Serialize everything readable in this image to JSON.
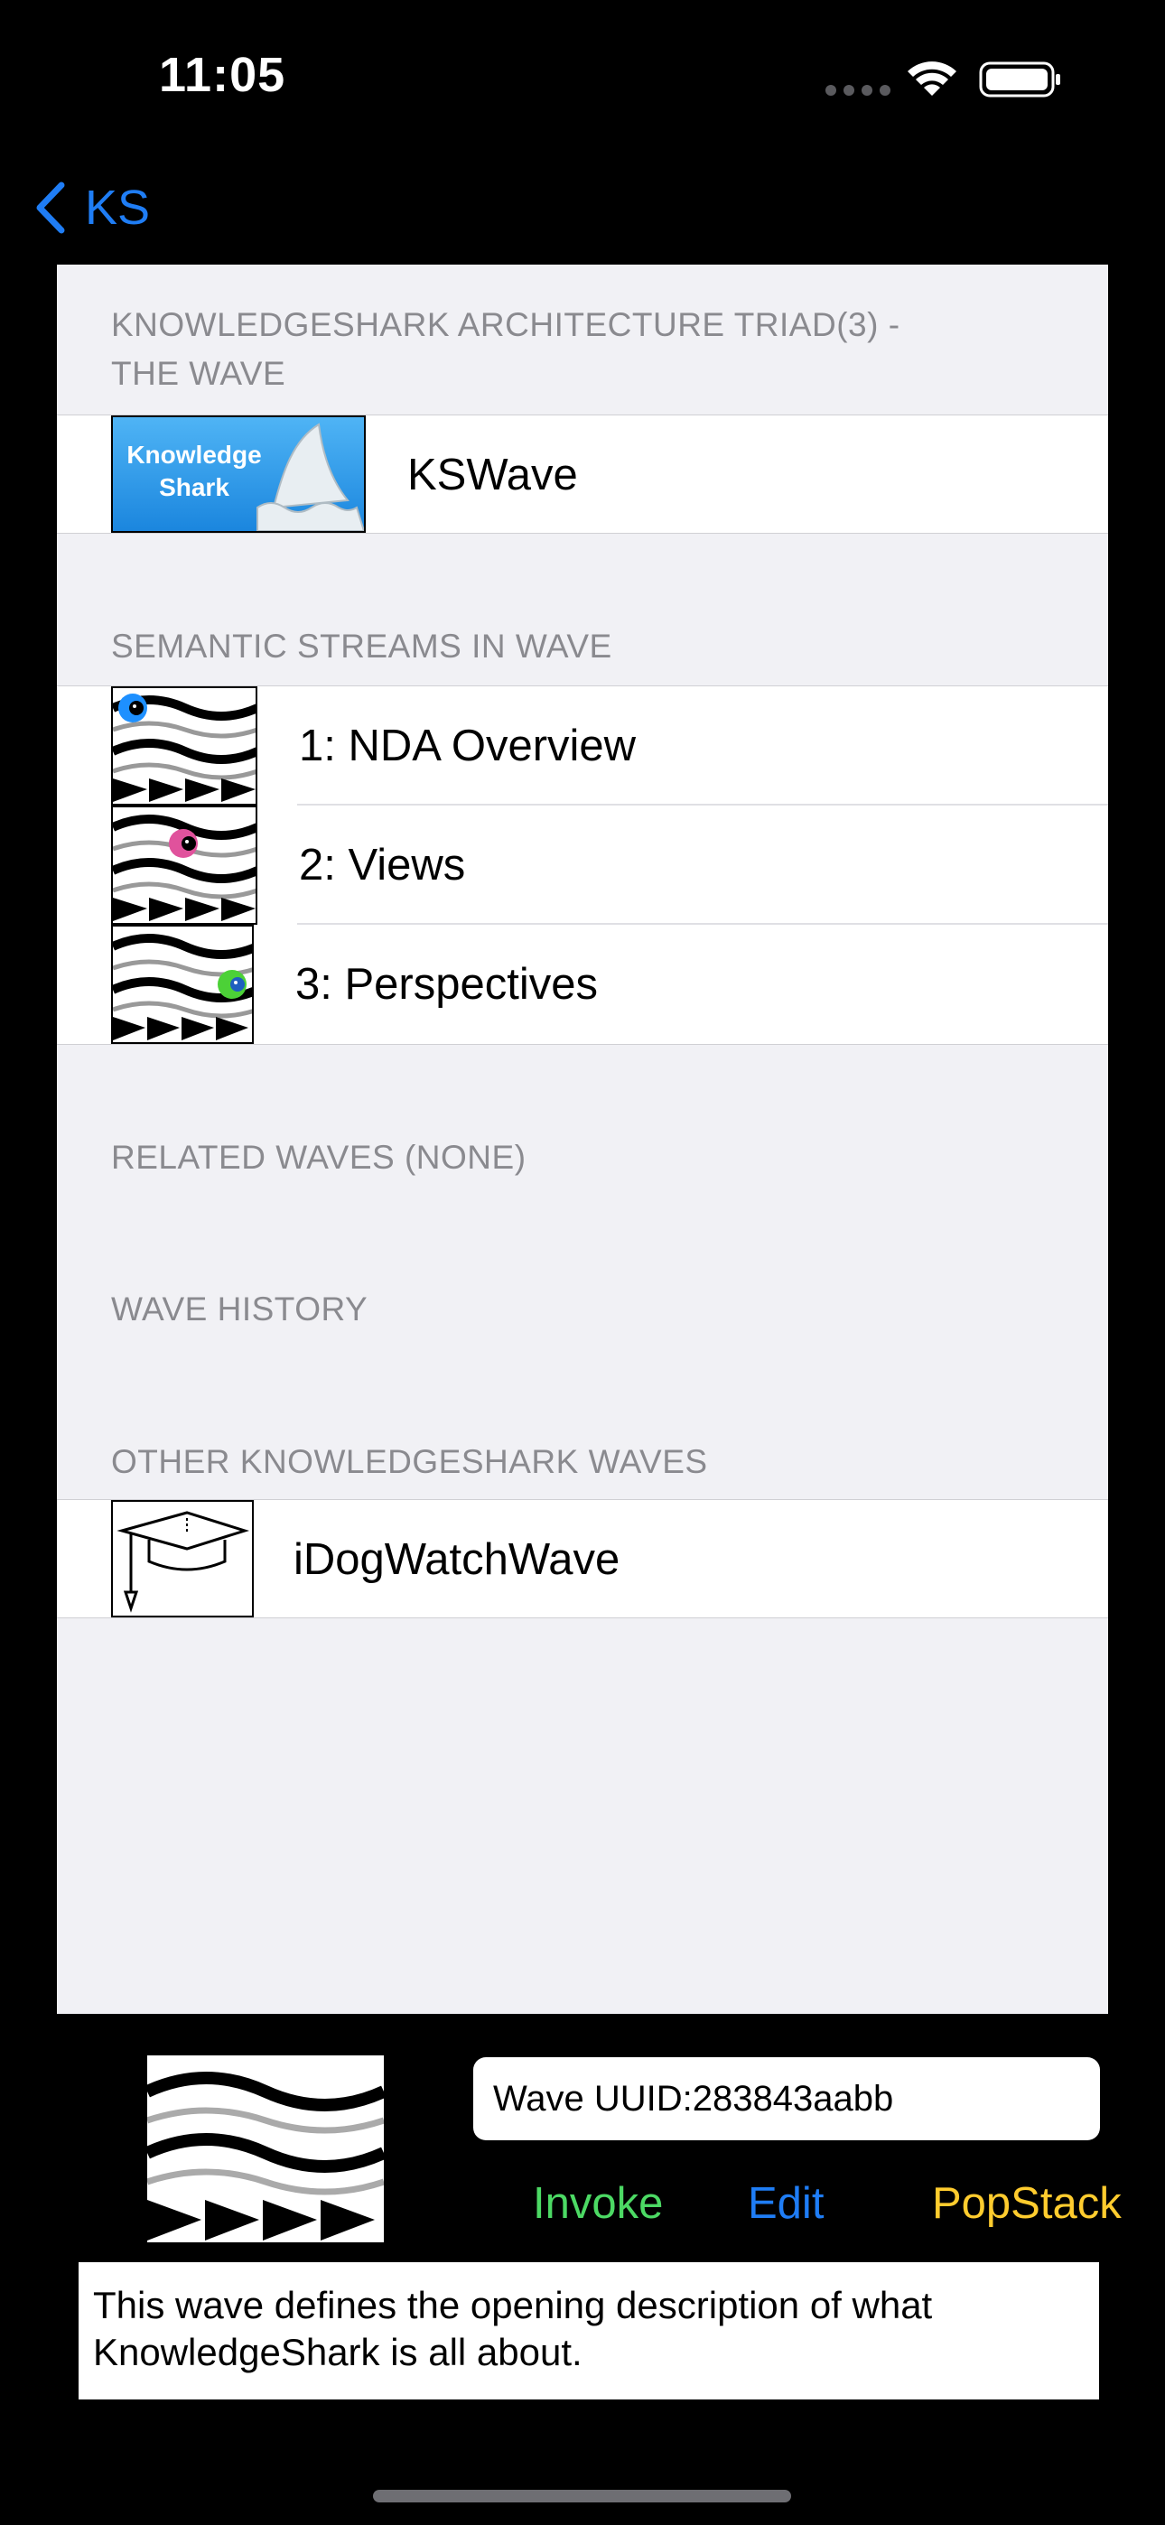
{
  "status_bar": {
    "time": "11:05"
  },
  "nav": {
    "back_label": "KS"
  },
  "sections": {
    "triad": {
      "header_line1": "KNOWLEDGESHARK ARCHITECTURE TRIAD(3) -",
      "header_line2": "THE WAVE",
      "row_label": "KSWave",
      "logo_line1": "Knowledge",
      "logo_line2": "Shark"
    },
    "streams": {
      "header": "SEMANTIC STREAMS IN WAVE",
      "items": [
        {
          "label": "1: NDA Overview",
          "dot_color": "#1e90ff"
        },
        {
          "label": "2: Views",
          "dot_color": "#e0529c"
        },
        {
          "label": "3: Perspectives",
          "dot_color": "#4cd137"
        }
      ]
    },
    "related": {
      "header": "RELATED WAVES (NONE)"
    },
    "history": {
      "header": "WAVE HISTORY"
    },
    "other": {
      "header": "OTHER KNOWLEDGESHARK WAVES",
      "row_label": "iDogWatchWave"
    }
  },
  "footer": {
    "uuid_text": "Wave UUID:283843aabb",
    "invoke_label": "Invoke",
    "edit_label": "Edit",
    "popstack_label": "PopStack",
    "description": "This wave defines the opening description of what KnowledgeShark is all about."
  },
  "colors": {
    "accent": "#1f7df5",
    "invoke": "#4cd964",
    "edit": "#1f7df5",
    "popstack": "#ffcc2e"
  }
}
